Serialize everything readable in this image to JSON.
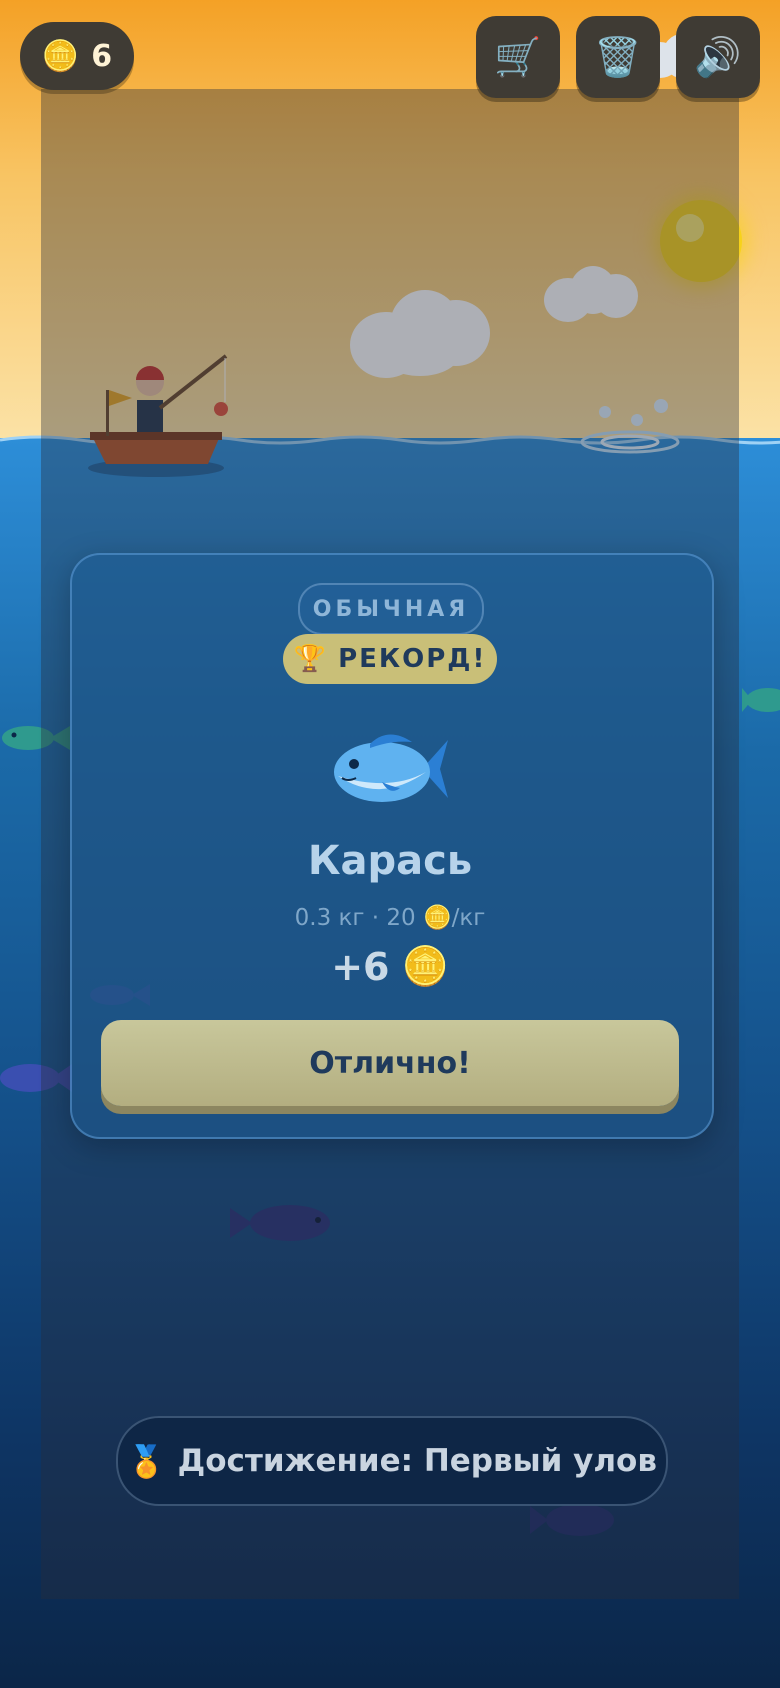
{
  "hud": {
    "coin_icon": "🪙",
    "coins": "6",
    "shop_icon": "🛒",
    "trash_icon": "🗑️",
    "sound_icon": "🔊"
  },
  "catch_card": {
    "rarity": "ОБЫЧНАЯ",
    "record_icon": "🏆",
    "record_label": "РЕКОРД!",
    "fish_name": "Карась",
    "meta": "0.3 кг · 20 🪙/кг",
    "reward": "+6",
    "reward_icon": "🪙",
    "confirm_label": "Отлично!"
  },
  "achievement": {
    "icon": "🏅",
    "text": "Достижение: Первый улов"
  },
  "colors": {
    "sky_top": "#f4a126",
    "water": "#1b6aa8",
    "button_gold": "#c8c79b",
    "text_navy": "#1f3a5c"
  }
}
